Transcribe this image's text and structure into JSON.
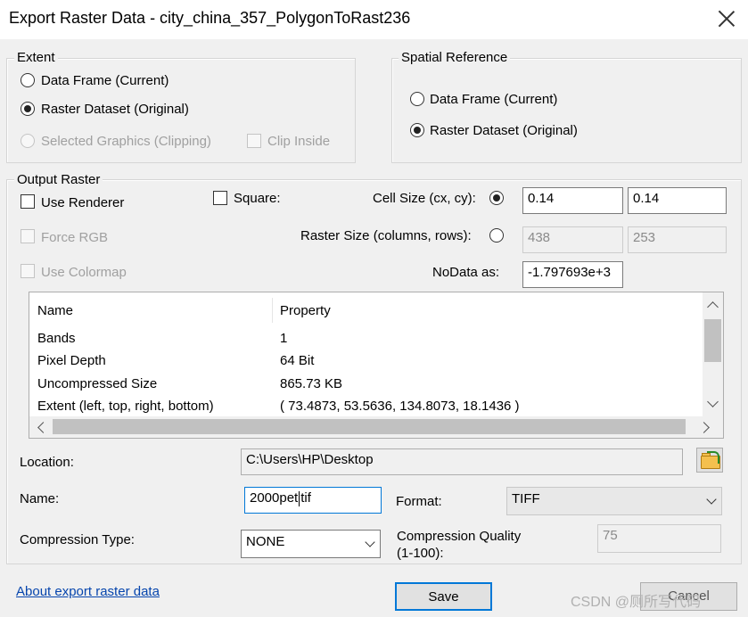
{
  "window": {
    "title": "Export Raster Data - city_china_357_PolygonToRast236"
  },
  "extent": {
    "label": "Extent",
    "data_frame": "Data Frame (Current)",
    "raster_dataset": "Raster Dataset (Original)",
    "selected_graphics": "Selected Graphics (Clipping)",
    "clip_inside": "Clip Inside",
    "selected": "raster_dataset"
  },
  "spatial_reference": {
    "label": "Spatial Reference",
    "data_frame": "Data Frame (Current)",
    "raster_dataset": "Raster Dataset (Original)",
    "selected": "raster_dataset"
  },
  "output_raster": {
    "label": "Output Raster",
    "use_renderer": "Use Renderer",
    "force_rgb": "Force RGB",
    "use_colormap": "Use Colormap",
    "square": "Square:",
    "cell_size_label": "Cell Size (cx, cy):",
    "cell_size_cx": "0.14",
    "cell_size_cy": "0.14",
    "raster_size_label": "Raster Size (columns, rows):",
    "raster_columns": "438",
    "raster_rows": "253",
    "nodata_label": "NoData as:",
    "nodata_value": "-1.797693e+3",
    "size_mode": "cell_size"
  },
  "properties": {
    "headers": [
      "Name",
      "Property"
    ],
    "rows": [
      [
        "Bands",
        "1"
      ],
      [
        "Pixel Depth",
        "64 Bit"
      ],
      [
        "Uncompressed Size",
        "865.73 KB"
      ],
      [
        "Extent (left, top, right, bottom)",
        "( 73.4873, 53.5636, 134.8073, 18.1436 )"
      ]
    ]
  },
  "location": {
    "label": "Location:",
    "value": "C:\\Users\\HP\\Desktop"
  },
  "name": {
    "label": "Name:",
    "value_before_caret": "2000pet",
    "value_after_caret": "tif"
  },
  "format": {
    "label": "Format:",
    "value": "TIFF"
  },
  "compression": {
    "type_label": "Compression Type:",
    "type_value": "NONE",
    "quality_label_1": "Compression Quality",
    "quality_label_2": "(1-100):",
    "quality_value": "75"
  },
  "footer": {
    "about_link": "About export raster data",
    "save": "Save",
    "cancel": "Cancel"
  },
  "watermark": "CSDN @厕所写代码",
  "icons": [
    "close-icon",
    "folder-open-icon",
    "scroll-up-icon",
    "scroll-down-icon",
    "scroll-left-icon",
    "scroll-right-icon",
    "chevron-down-icon"
  ]
}
